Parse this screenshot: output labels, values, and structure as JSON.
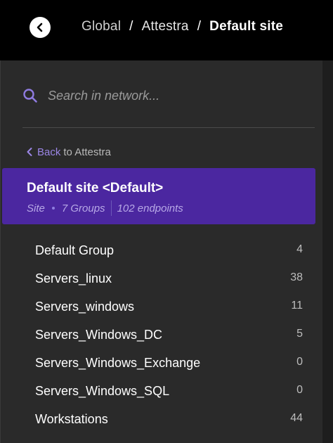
{
  "breadcrumb": {
    "items": [
      "Global",
      "Attestra",
      "Default site"
    ],
    "separator": "/"
  },
  "search": {
    "placeholder": "Search in network..."
  },
  "back_link": {
    "link_text": "Back",
    "rest_text": "to Attestra"
  },
  "site": {
    "title": "Default site <Default>",
    "type": "Site",
    "groups": "7 Groups",
    "endpoints": "102 endpoints"
  },
  "groups": [
    {
      "name": "Default Group",
      "count": "4"
    },
    {
      "name": "Servers_linux",
      "count": "38"
    },
    {
      "name": "Servers_windows",
      "count": "11"
    },
    {
      "name": "Servers_Windows_DC",
      "count": "5"
    },
    {
      "name": "Servers_Windows_Exchange",
      "count": "0"
    },
    {
      "name": "Servers_Windows_SQL",
      "count": "0"
    },
    {
      "name": "Workstations",
      "count": "44"
    }
  ],
  "colors": {
    "accent": "#4b27a0",
    "link": "#9b86e6",
    "background": "#2a2a2a"
  },
  "icons": {
    "back_button": "chevron-left-icon",
    "search": "search-icon",
    "back_link": "chevron-left-icon"
  }
}
